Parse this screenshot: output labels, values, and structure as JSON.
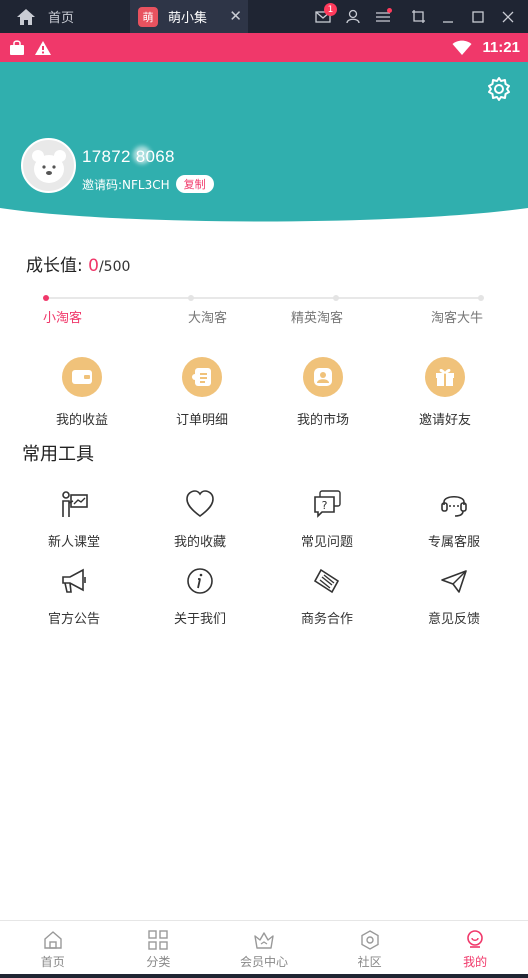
{
  "emulator": {
    "home_label": "首页",
    "tab_icon_char": "萌",
    "tab_title": "萌小集",
    "mail_badge": "1"
  },
  "status_bar": {
    "time": "11:21"
  },
  "profile": {
    "phone": "17872  8068",
    "invite_label": "邀请码:NFL3CH",
    "copy_label": "复制"
  },
  "growth": {
    "label": "成长值: ",
    "current": "0",
    "max": "/500",
    "progress_fraction": 0.0,
    "levels": [
      "小淘客",
      "大淘客",
      "精英淘客",
      "淘客大牛"
    ]
  },
  "quick_actions": [
    {
      "label": "我的收益",
      "icon": "wallet-icon"
    },
    {
      "label": "订单明细",
      "icon": "receipt-icon"
    },
    {
      "label": "我的市场",
      "icon": "people-icon"
    },
    {
      "label": "邀请好友",
      "icon": "gift-icon"
    }
  ],
  "tools_title": "常用工具",
  "tools": [
    {
      "label": "新人课堂",
      "icon": "classroom-icon"
    },
    {
      "label": "我的收藏",
      "icon": "heart-icon"
    },
    {
      "label": "常见问题",
      "icon": "question-icon"
    },
    {
      "label": "专属客服",
      "icon": "headset-icon"
    },
    {
      "label": "官方公告",
      "icon": "megaphone-icon"
    },
    {
      "label": "关于我们",
      "icon": "info-icon"
    },
    {
      "label": "商务合作",
      "icon": "handshake-icon"
    },
    {
      "label": "意见反馈",
      "icon": "paper-plane-icon"
    }
  ],
  "bottom_nav": [
    {
      "label": "首页",
      "icon": "home-icon"
    },
    {
      "label": "分类",
      "icon": "grid-icon"
    },
    {
      "label": "会员中心",
      "icon": "crown-icon"
    },
    {
      "label": "社区",
      "icon": "hexagon-icon"
    },
    {
      "label": "我的",
      "icon": "profile-icon",
      "active": true
    }
  ],
  "colors": {
    "accent": "#f0386a",
    "header_teal": "#30afae",
    "gold": "#f0c27a"
  }
}
